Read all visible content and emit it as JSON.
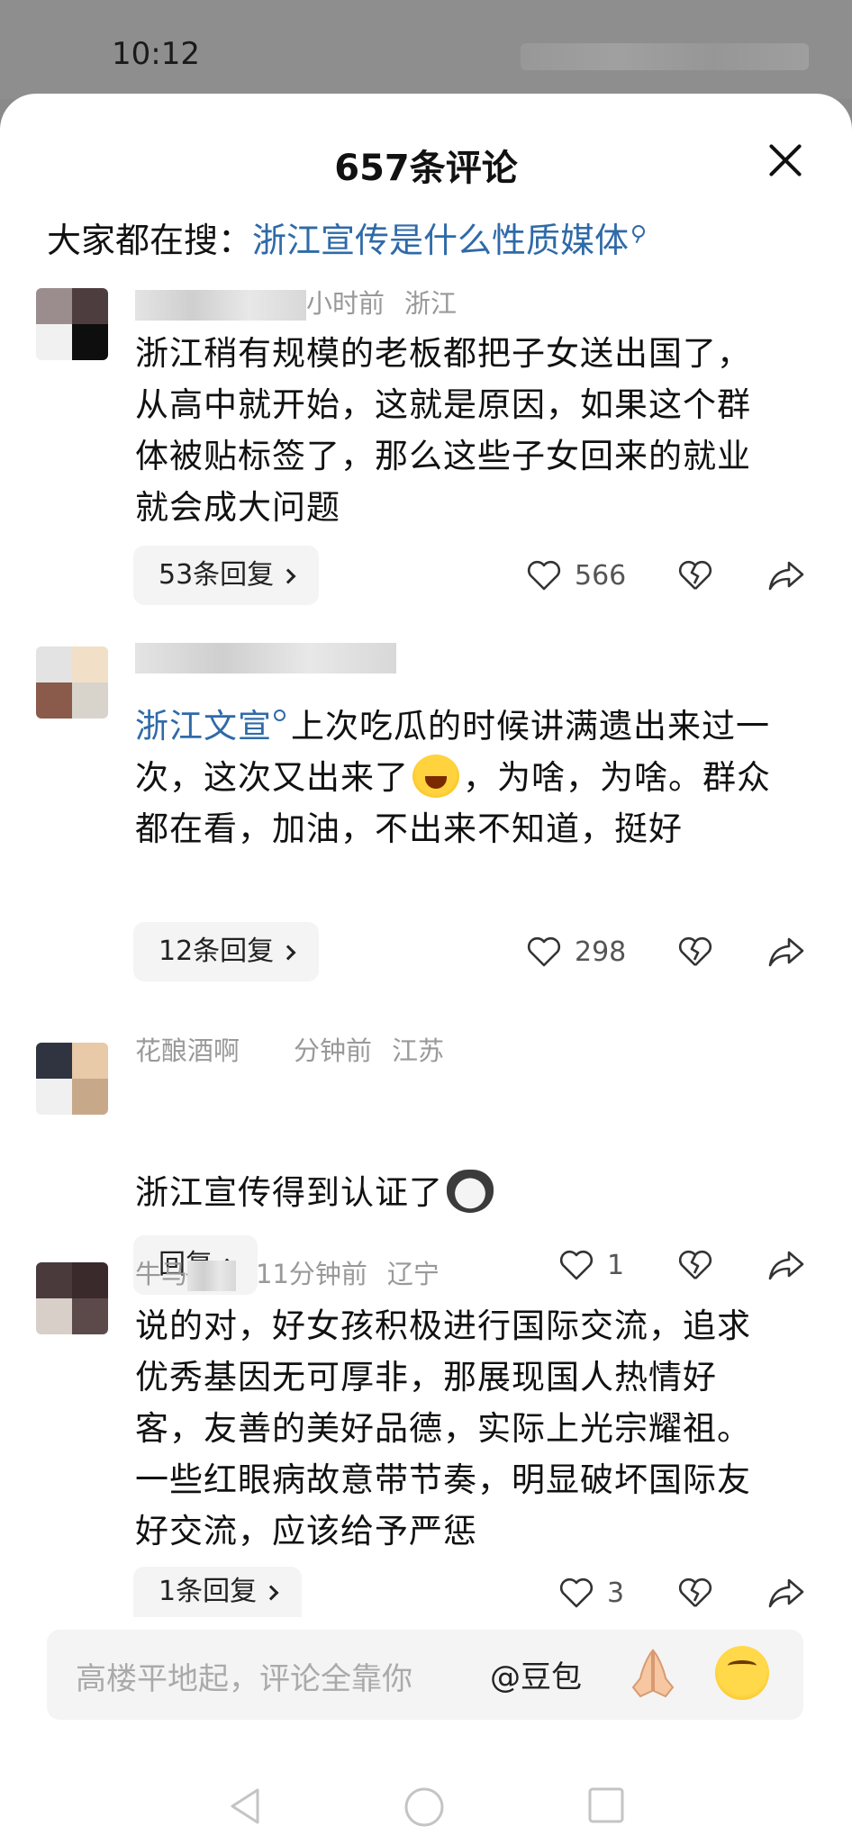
{
  "status_bar": {
    "time": "10:12"
  },
  "sheet": {
    "title": "657条评论",
    "search_prefix": "大家都在搜：",
    "search_query": "浙江宣传是什么性质媒体"
  },
  "comments": [
    {
      "meta_visible": "小时前",
      "location": "浙江",
      "text": "浙江稍有规模的老板都把子女送出国了，从高中就开始，这就是原因，如果这个群体被贴标签了，那么这些子女回来的就业就会成大问题",
      "reply_label": "53条回复",
      "likes": "566"
    },
    {
      "mention": "浙江文宣",
      "text_a": "上次吃瓜的时候讲满遗出来过一次，这次又出来了",
      "text_b": "，为啥，为啥。群众都在看，加油，不出来不知道，挺好",
      "reply_label": "12条回复",
      "likes": "298"
    },
    {
      "user": "花酿酒啊",
      "time": "分钟前",
      "location": "江苏",
      "text": "浙江宣传得到认证了",
      "reply_label": "回复",
      "likes": "1"
    },
    {
      "user": "牛马",
      "time": "11分钟前",
      "location": "辽宁",
      "text": "说的对，好女孩积极进行国际交流，追求优秀基因无可厚非，那展现国人热情好客，友善的美好品德，实际上光宗耀祖。一些红眼病故意带节奏，明显破坏国际友好交流，应该给予严惩",
      "reply_label": "1条回复",
      "likes": "3"
    }
  ],
  "input_bar": {
    "placeholder": "高楼平地起，评论全靠你",
    "mention": "@豆包"
  },
  "icons": {
    "like": "heart-outline-icon",
    "dislike": "broken-heart-icon",
    "share": "share-arrow-icon"
  },
  "colors": {
    "link": "#2f6aa8",
    "background": "#ffffff",
    "reply_button_bg": "#f4f4f4"
  }
}
